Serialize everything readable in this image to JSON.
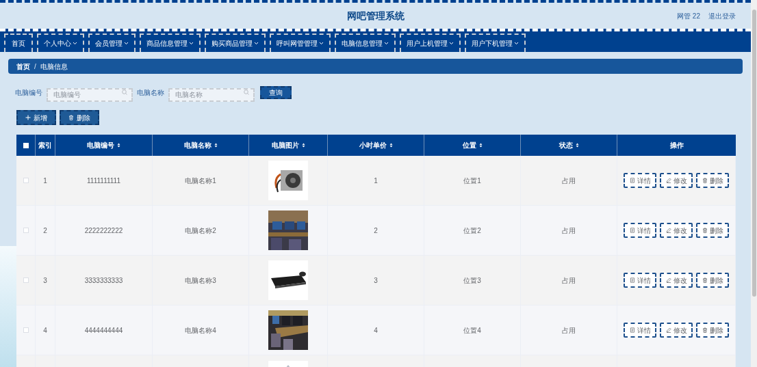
{
  "header": {
    "title": "网吧管理系统",
    "user": "网管 22",
    "logout": "退出登录"
  },
  "nav": [
    {
      "label": "首页",
      "dropdown": false
    },
    {
      "label": "个人中心",
      "dropdown": true
    },
    {
      "label": "会员管理",
      "dropdown": true
    },
    {
      "label": "商品信息管理",
      "dropdown": true
    },
    {
      "label": "购买商品管理",
      "dropdown": true
    },
    {
      "label": "呼叫网管管理",
      "dropdown": true
    },
    {
      "label": "电脑信息管理",
      "dropdown": true
    },
    {
      "label": "用户上机管理",
      "dropdown": true
    },
    {
      "label": "用户下机管理",
      "dropdown": true
    }
  ],
  "breadcrumb": {
    "items": [
      "首页",
      "电脑信息"
    ],
    "separator": "/"
  },
  "search": [
    {
      "label": "电脑编号",
      "placeholder": "电脑编号"
    },
    {
      "label": "电脑名称",
      "placeholder": "电脑名称"
    }
  ],
  "search_button": "查询",
  "actions": [
    {
      "label": "新增",
      "kind": "add"
    },
    {
      "label": "删除",
      "kind": "delete"
    }
  ],
  "table": {
    "select_all": false,
    "columns": [
      {
        "label": "索引",
        "sortable": false
      },
      {
        "label": "电脑编号",
        "sortable": true
      },
      {
        "label": "电脑名称",
        "sortable": true
      },
      {
        "label": "电脑图片",
        "sortable": true
      },
      {
        "label": "小时单价",
        "sortable": true
      },
      {
        "label": "位置",
        "sortable": true
      },
      {
        "label": "状态",
        "sortable": true
      },
      {
        "label": "操作",
        "sortable": false
      }
    ],
    "rows": [
      {
        "checked": false,
        "index": "1",
        "number": "1111111111",
        "name": "电脑名称1",
        "image": {
          "kind": "picture"
        },
        "price": "1",
        "location": "位置1",
        "status": "占用",
        "actions": [
          {
            "label": "详情",
            "kind": "detail"
          },
          {
            "label": "修改",
            "kind": "edit"
          },
          {
            "label": "删除",
            "kind": "delete"
          }
        ]
      },
      {
        "checked": false,
        "index": "2",
        "number": "2222222222",
        "name": "电脑名称2",
        "image": {
          "kind": "picture"
        },
        "price": "2",
        "location": "位置2",
        "status": "占用",
        "actions": [
          {
            "label": "详情",
            "kind": "detail"
          },
          {
            "label": "修改",
            "kind": "edit"
          },
          {
            "label": "删除",
            "kind": "delete"
          }
        ]
      },
      {
        "checked": false,
        "index": "3",
        "number": "3333333333",
        "name": "电脑名称3",
        "image": {
          "kind": "picture"
        },
        "price": "3",
        "location": "位置3",
        "status": "占用",
        "actions": [
          {
            "label": "详情",
            "kind": "detail"
          },
          {
            "label": "修改",
            "kind": "edit"
          },
          {
            "label": "删除",
            "kind": "delete"
          }
        ]
      },
      {
        "checked": false,
        "index": "4",
        "number": "4444444444",
        "name": "电脑名称4",
        "image": {
          "kind": "picture"
        },
        "price": "4",
        "location": "位置4",
        "status": "占用",
        "actions": [
          {
            "label": "详情",
            "kind": "detail"
          },
          {
            "label": "修改",
            "kind": "edit"
          },
          {
            "label": "删除",
            "kind": "delete"
          }
        ]
      }
    ],
    "more_rows": true
  }
}
